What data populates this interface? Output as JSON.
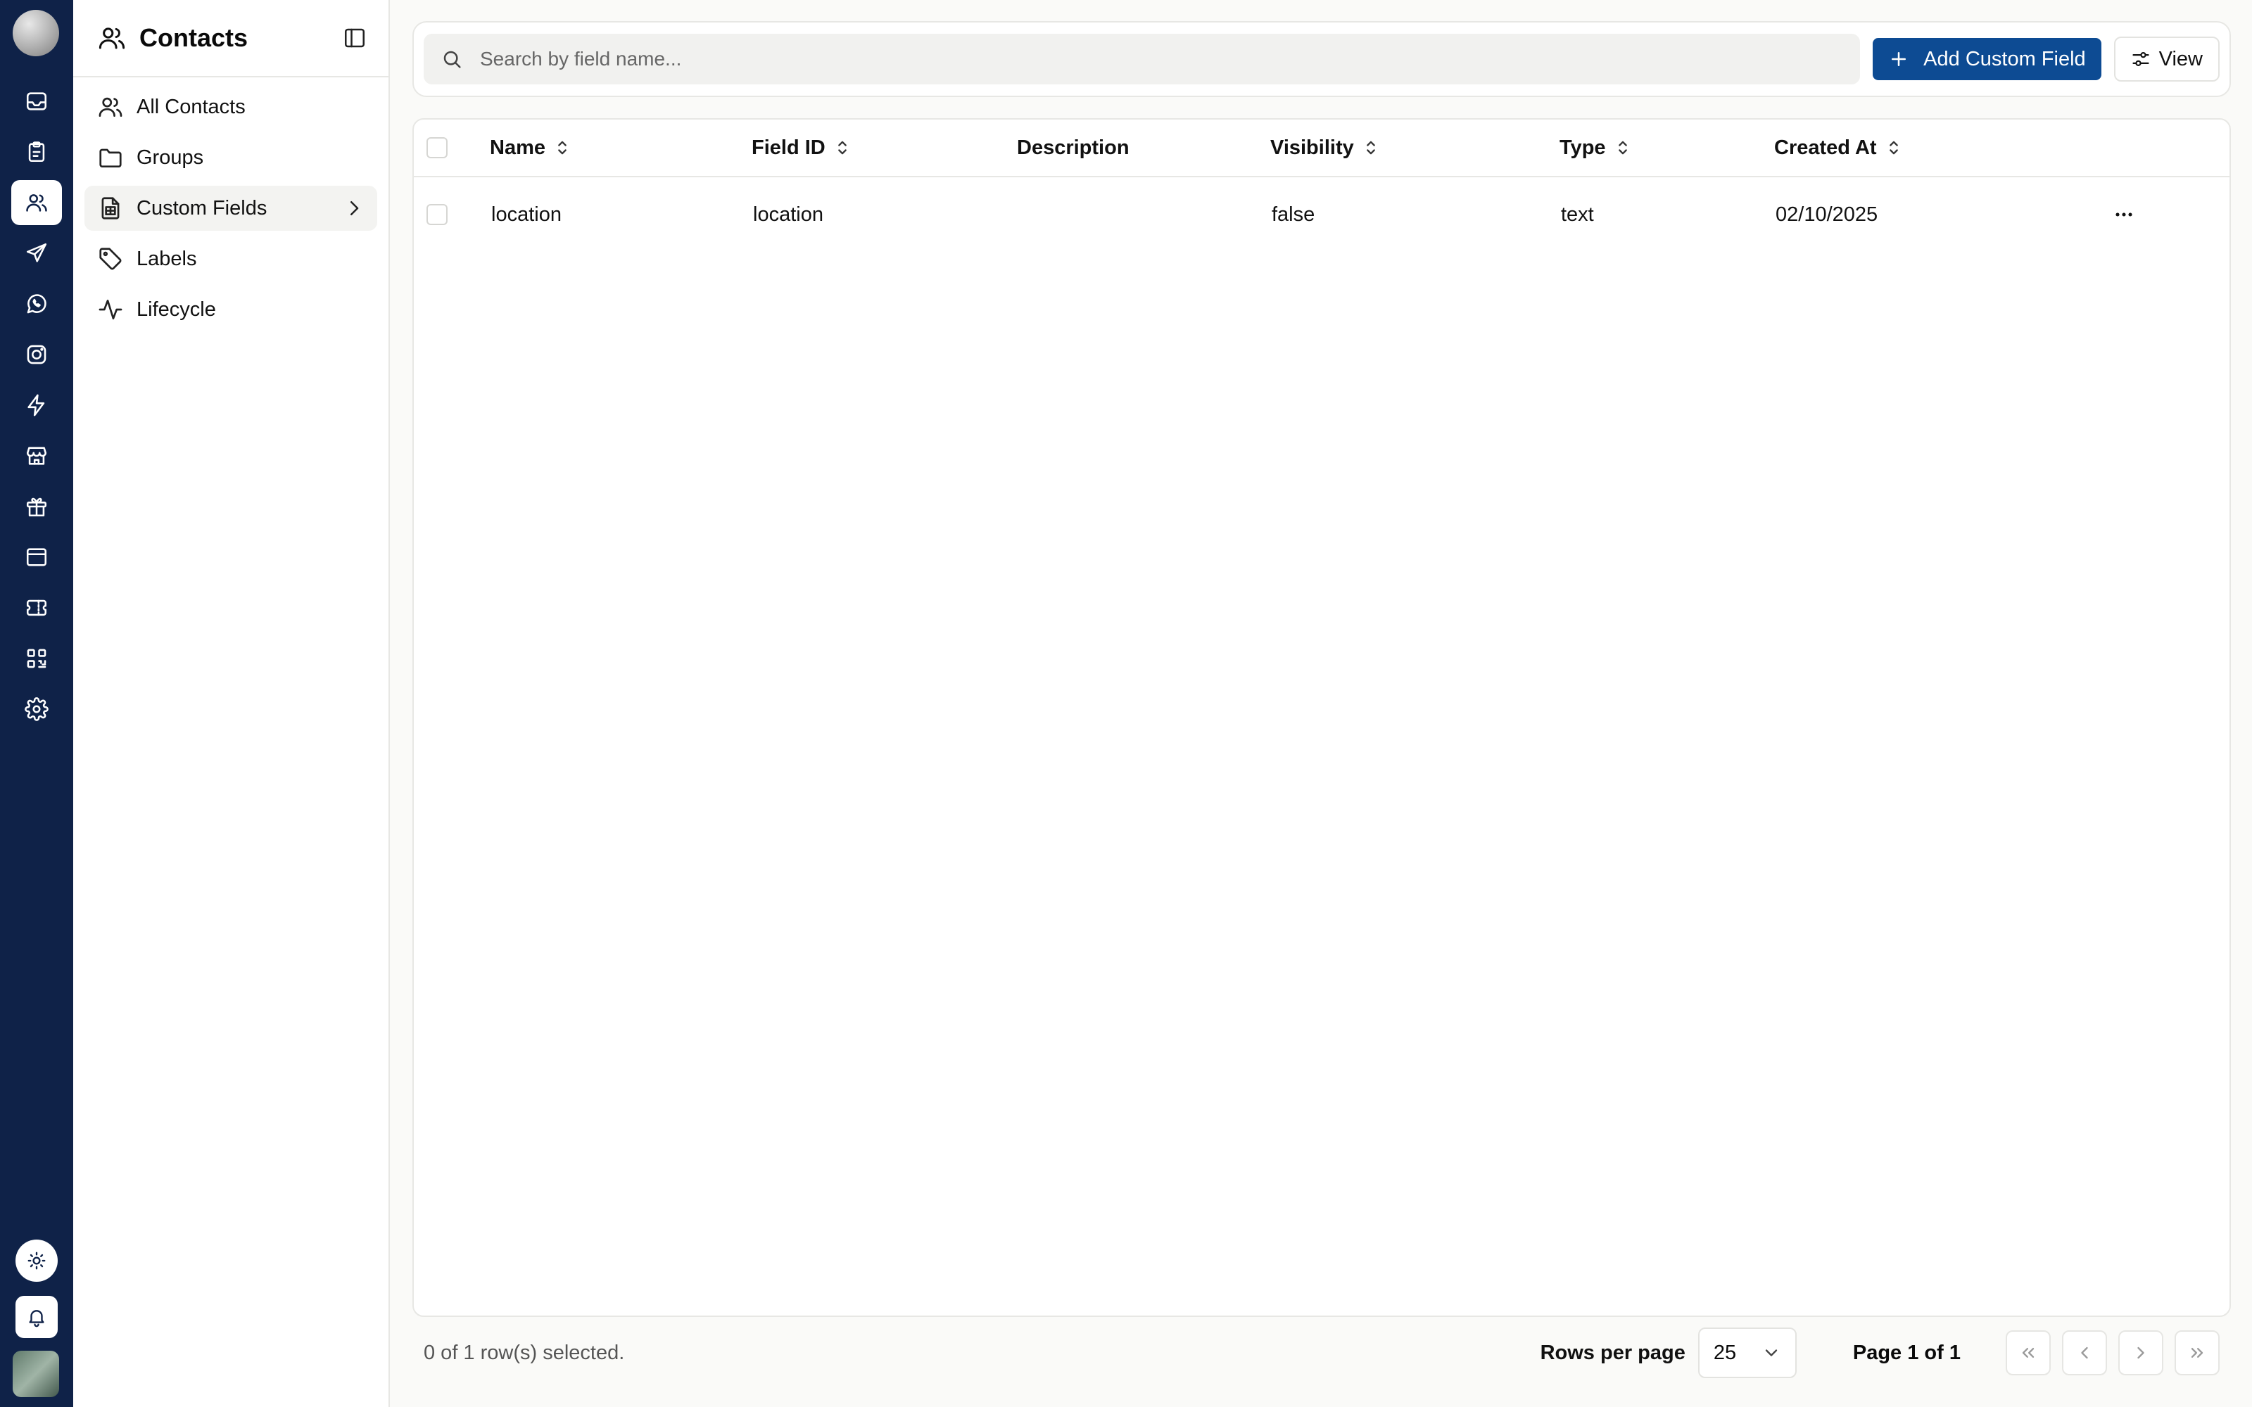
{
  "rail": {
    "items": [
      {
        "name": "inbox-icon"
      },
      {
        "name": "clipboard-icon"
      },
      {
        "name": "users-icon",
        "active": true
      },
      {
        "name": "send-icon"
      },
      {
        "name": "whatsapp-icon"
      },
      {
        "name": "instagram-icon"
      },
      {
        "name": "zap-icon"
      },
      {
        "name": "store-icon"
      },
      {
        "name": "gift-icon"
      },
      {
        "name": "browser-icon"
      },
      {
        "name": "ticket-icon"
      },
      {
        "name": "qr-code-icon"
      },
      {
        "name": "settings-icon"
      }
    ],
    "bottom": [
      "sun-icon",
      "bell-icon"
    ]
  },
  "sidebar": {
    "title": "Contacts",
    "items": [
      {
        "label": "All Contacts",
        "icon": "users-icon"
      },
      {
        "label": "Groups",
        "icon": "folder-icon"
      },
      {
        "label": "Custom Fields",
        "icon": "file-spreadsheet-icon",
        "active": true
      },
      {
        "label": "Labels",
        "icon": "tag-icon"
      },
      {
        "label": "Lifecycle",
        "icon": "activity-icon"
      }
    ]
  },
  "toolbar": {
    "search_placeholder": "Search by field name...",
    "add_label": "Add Custom Field",
    "view_label": "View"
  },
  "table": {
    "columns": [
      "Name",
      "Field ID",
      "Description",
      "Visibility",
      "Type",
      "Created At"
    ],
    "rows": [
      {
        "name": "location",
        "field_id": "location",
        "description": "",
        "visibility": "false",
        "type": "text",
        "created_at": "02/10/2025"
      }
    ]
  },
  "footer": {
    "selected_text": "0 of 1 row(s) selected.",
    "rows_per_page_label": "Rows per page",
    "rows_per_page_value": "25",
    "page_info": "Page 1 of 1"
  },
  "colors": {
    "rail_bg": "#0f2248",
    "primary": "#0d4b93"
  }
}
